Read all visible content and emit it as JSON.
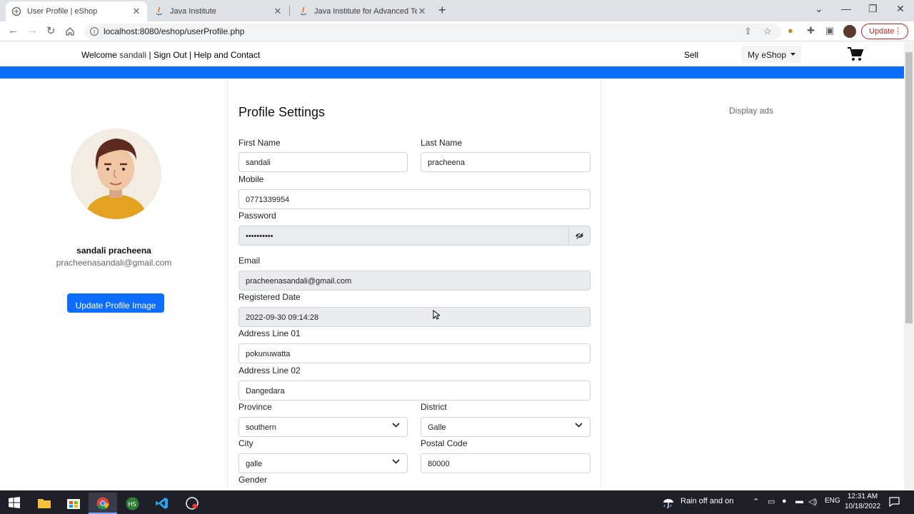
{
  "browser": {
    "tabs": [
      {
        "title": "User Profile | eShop",
        "active": true
      },
      {
        "title": "Java Institute",
        "active": false
      },
      {
        "title": "Java Institute for Advanced Techno",
        "active": false
      }
    ],
    "url": "localhost:8080/eshop/userProfile.php",
    "update_label": "Update"
  },
  "header": {
    "welcome_label": "Welcome",
    "username": "sandali",
    "sep1": " | ",
    "signout_label": "Sign Out",
    "sep2": " | ",
    "help_label": "Help and Contact",
    "sell_label": "Sell",
    "myeshop_label": "My eShop"
  },
  "profile": {
    "full_name": "sandali pracheena",
    "email": "pracheenasandali@gmail.com",
    "update_image_label": "Update Profile Image"
  },
  "form": {
    "title": "Profile Settings",
    "first_name_label": "First Name",
    "first_name_value": "sandali",
    "last_name_label": "Last Name",
    "last_name_value": "pracheena",
    "mobile_label": "Mobile",
    "mobile_value": "0771339954",
    "password_label": "Password",
    "password_value": "••••••••••",
    "email_label": "Email",
    "email_value": "pracheenasandali@gmail.com",
    "registered_label": "Registered Date",
    "registered_value": "2022-09-30 09:14:28",
    "address1_label": "Address Line 01",
    "address1_value": "pokunuwatta",
    "address2_label": "Address Line 02",
    "address2_value": "Dangedara",
    "province_label": "Province",
    "province_value": "southern",
    "district_label": "District",
    "district_value": "Galle",
    "city_label": "City",
    "city_value": "galle",
    "postal_label": "Postal Code",
    "postal_value": "80000",
    "gender_label": "Gender"
  },
  "sidebar_right": {
    "ads_label": "Display ads"
  },
  "taskbar": {
    "weather": "Rain off and on",
    "lang": "ENG",
    "time": "12:31 AM",
    "date": "10/18/2022"
  },
  "colors": {
    "primary": "#0d6efd",
    "chrome_tabbar": "#dee1e6",
    "taskbar": "#1f1f2a"
  }
}
